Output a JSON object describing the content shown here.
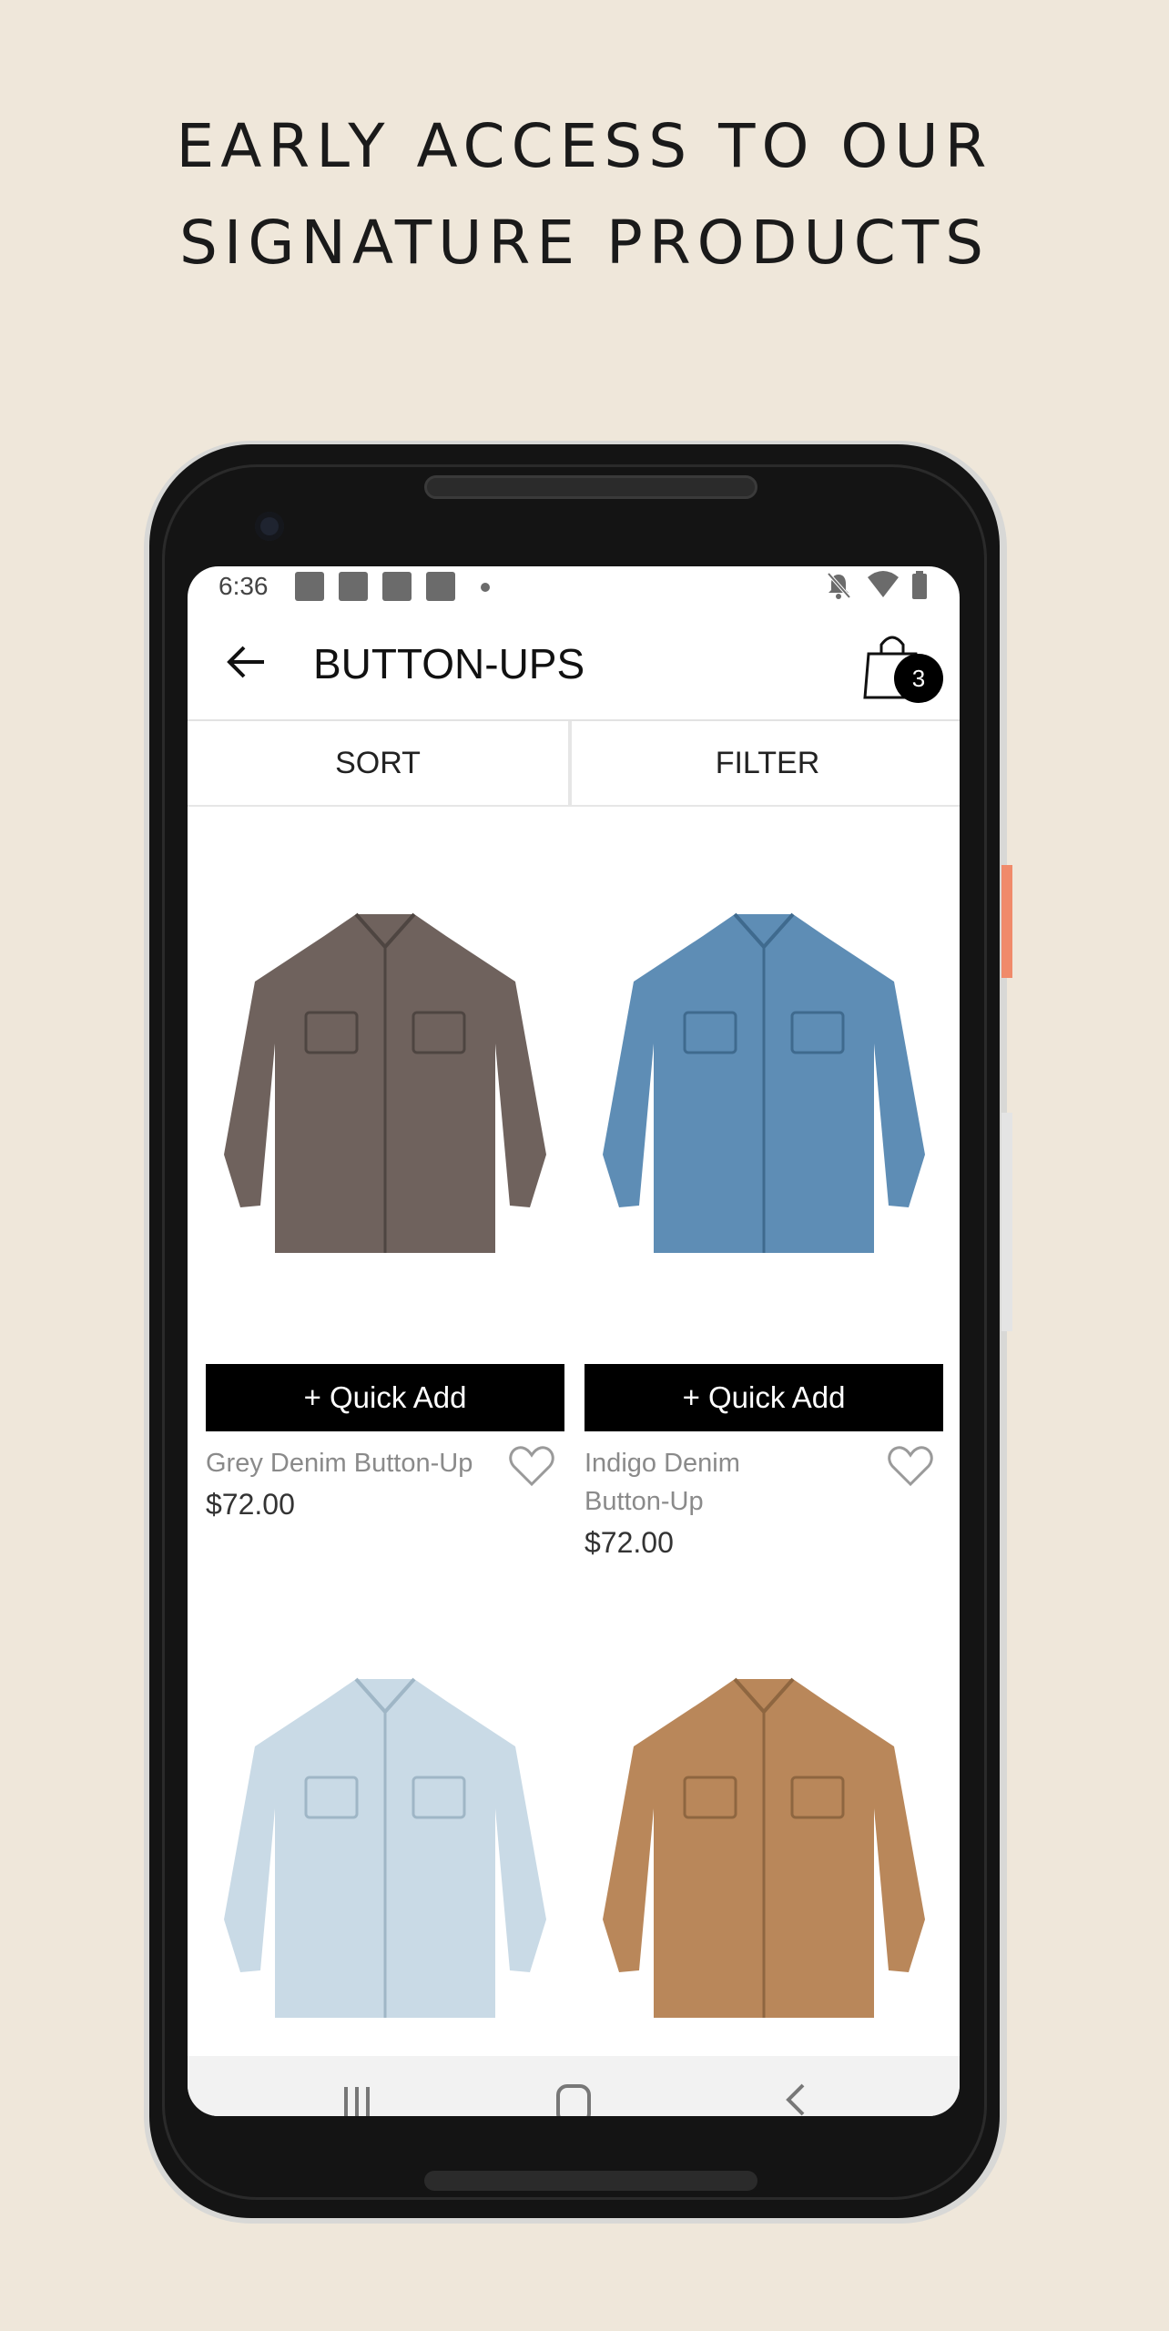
{
  "promo": {
    "headline_line1": "EARLY ACCESS TO OUR",
    "headline_line2": "SIGNATURE PRODUCTS"
  },
  "status_bar": {
    "time": "6:36",
    "icons": [
      "notification-square-icon",
      "notification-square-icon",
      "notification-square-icon",
      "notification-square-icon",
      "more-notifications-dot-icon",
      "bell-off-icon",
      "wifi-icon",
      "battery-icon"
    ]
  },
  "app_bar": {
    "back_icon": "arrow-left-icon",
    "title": "BUTTON-UPS",
    "cart_icon": "shopping-bag-icon",
    "cart_count": "3"
  },
  "toolbar": {
    "sort_label": "SORT",
    "filter_label": "FILTER"
  },
  "products": [
    {
      "name": "Grey Denim Button-Up",
      "price": "$72.00",
      "quick_add": "+ Quick Add",
      "shirt_color": "#6f625d"
    },
    {
      "name_line1": "Indigo Denim",
      "name_line2": "Button-Up",
      "price": "$72.00",
      "quick_add": "+ Quick Add",
      "shirt_color": "#5e8db5"
    },
    {
      "shirt_color": "#c9dae6"
    },
    {
      "shirt_color": "#b9875a"
    }
  ],
  "nav_bar": {
    "icons": [
      "recent-apps-icon",
      "home-icon",
      "back-icon"
    ]
  },
  "colors": {
    "page_background": "#efe7da",
    "quick_add_background": "#000000",
    "badge_background": "#000000"
  }
}
